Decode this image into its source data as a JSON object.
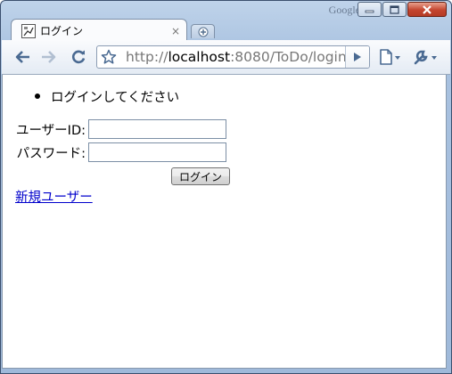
{
  "window": {
    "brand_label": "Google"
  },
  "tab": {
    "title": "ログイン",
    "close_glyph": "×",
    "new_tab_glyph": "+"
  },
  "toolbar": {
    "url_scheme": "http://",
    "url_host": "localhost",
    "url_rest": ":8080/ToDo/login"
  },
  "page": {
    "messages": [
      "ログインしてください"
    ],
    "userid_label": "ユーザーID:",
    "userid_value": "",
    "password_label": "パスワード:",
    "password_value": "",
    "login_button_label": "ログイン",
    "new_user_link": "新規ユーザー"
  }
}
